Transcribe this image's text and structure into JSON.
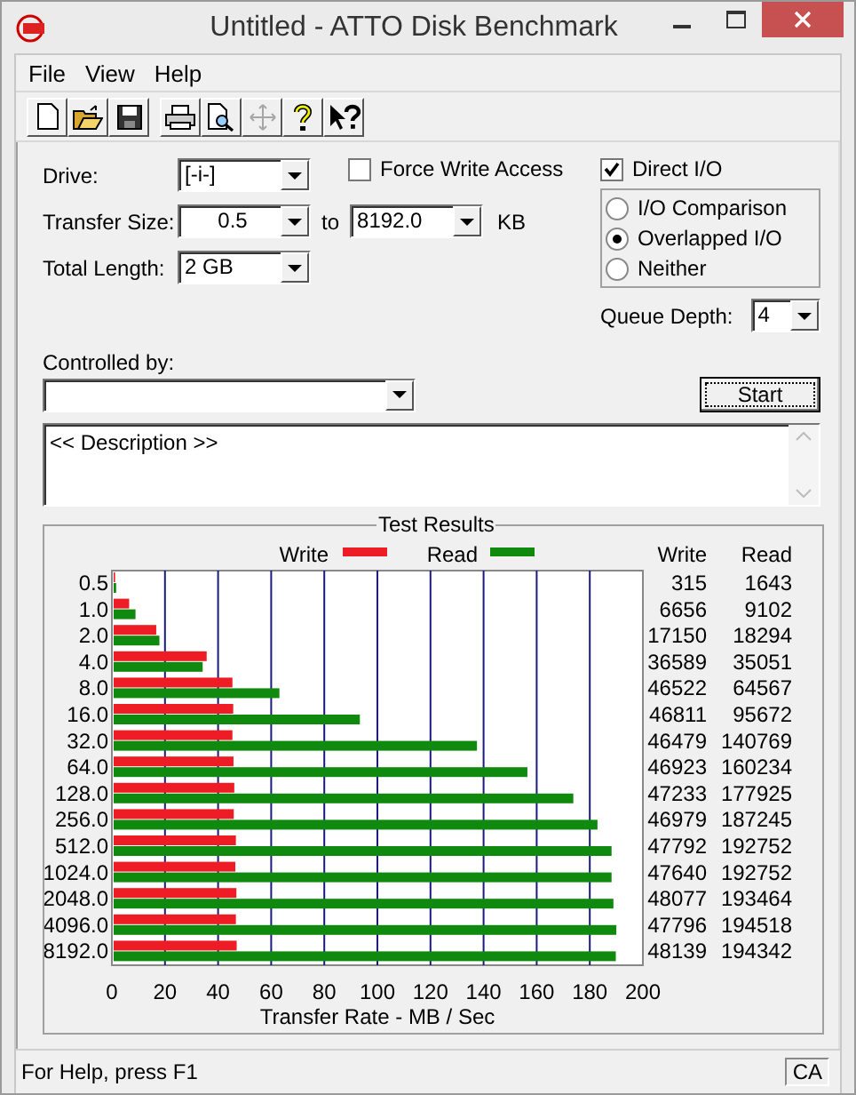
{
  "window": {
    "title": "Untitled - ATTO Disk Benchmark"
  },
  "menu": [
    {
      "label": "File"
    },
    {
      "label": "View"
    },
    {
      "label": "Help"
    }
  ],
  "toolbar": [
    [
      {
        "kind": "new",
        "disabled": false
      },
      {
        "kind": "open",
        "disabled": false
      },
      {
        "kind": "save",
        "disabled": false
      }
    ],
    [
      {
        "kind": "print",
        "disabled": false
      },
      {
        "kind": "preview",
        "disabled": false
      },
      {
        "kind": "move",
        "disabled": true
      },
      {
        "kind": "help",
        "disabled": false
      },
      {
        "kind": "context-help",
        "disabled": false
      }
    ]
  ],
  "form": {
    "drive": {
      "label": "Drive:",
      "value": "[-i-]"
    },
    "transfer_size": {
      "label": "Transfer Size:",
      "from": "0.5",
      "to_label": "to",
      "to": "8192.0",
      "unit": "KB"
    },
    "total_length": {
      "label": "Total Length:",
      "value": "2 GB"
    },
    "force_write_access": {
      "label": "Force Write Access",
      "checked": false
    },
    "direct_io": {
      "label": "Direct I/O",
      "checked": true
    },
    "io_modes": [
      {
        "label": "I/O Comparison",
        "selected": false
      },
      {
        "label": "Overlapped I/O",
        "selected": true
      },
      {
        "label": "Neither",
        "selected": false
      }
    ],
    "queue_depth": {
      "label": "Queue Depth:",
      "value": "4"
    },
    "controlled_by": {
      "label": "Controlled by:"
    },
    "start_button": "Start",
    "description": "<< Description >>"
  },
  "results": {
    "columns": [
      "Write",
      "Read"
    ],
    "rows": [
      {
        "write": "315",
        "read": "1643"
      },
      {
        "write": "6656",
        "read": "9102"
      },
      {
        "write": "17150",
        "read": "18294"
      },
      {
        "write": "36589",
        "read": "35051"
      },
      {
        "write": "46522",
        "read": "64567"
      },
      {
        "write": "46811",
        "read": "95672"
      },
      {
        "write": "46479",
        "read": "140769"
      },
      {
        "write": "46923",
        "read": "160234"
      },
      {
        "write": "47233",
        "read": "177925"
      },
      {
        "write": "46979",
        "read": "187245"
      },
      {
        "write": "47792",
        "read": "192752"
      },
      {
        "write": "47640",
        "read": "192752"
      },
      {
        "write": "48077",
        "read": "193464"
      },
      {
        "write": "47796",
        "read": "194518"
      },
      {
        "write": "48139",
        "read": "194342"
      }
    ],
    "chart_data": {
      "type": "bar",
      "orientation": "horizontal",
      "title": "Test Results",
      "xlabel": "Transfer Rate - MB / Sec",
      "categories": [
        "0.5",
        "1.0",
        "2.0",
        "4.0",
        "8.0",
        "16.0",
        "32.0",
        "64.0",
        "128.0",
        "256.0",
        "512.0",
        "1024.0",
        "2048.0",
        "4096.0",
        "8192.0"
      ],
      "series": [
        {
          "name": "Write",
          "color": "#ee1c24",
          "values": [
            0.3,
            6.5,
            16.7,
            35.7,
            45.4,
            45.7,
            45.4,
            45.8,
            46.1,
            45.9,
            46.7,
            46.5,
            46.9,
            46.7,
            47.0
          ]
        },
        {
          "name": "Read",
          "color": "#0f8a0f",
          "values": [
            1.6,
            8.9,
            17.9,
            34.2,
            63.1,
            93.4,
            137.5,
            156.5,
            173.8,
            182.9,
            188.2,
            188.2,
            188.9,
            190.0,
            189.8
          ]
        }
      ],
      "xlim": [
        0,
        200
      ],
      "grid": true,
      "legend": "top",
      "xticks": [
        0,
        20,
        40,
        60,
        80,
        100,
        120,
        140,
        160,
        180,
        200
      ]
    }
  },
  "status_bar": {
    "text": "For Help, press F1",
    "indicator": "CA"
  }
}
